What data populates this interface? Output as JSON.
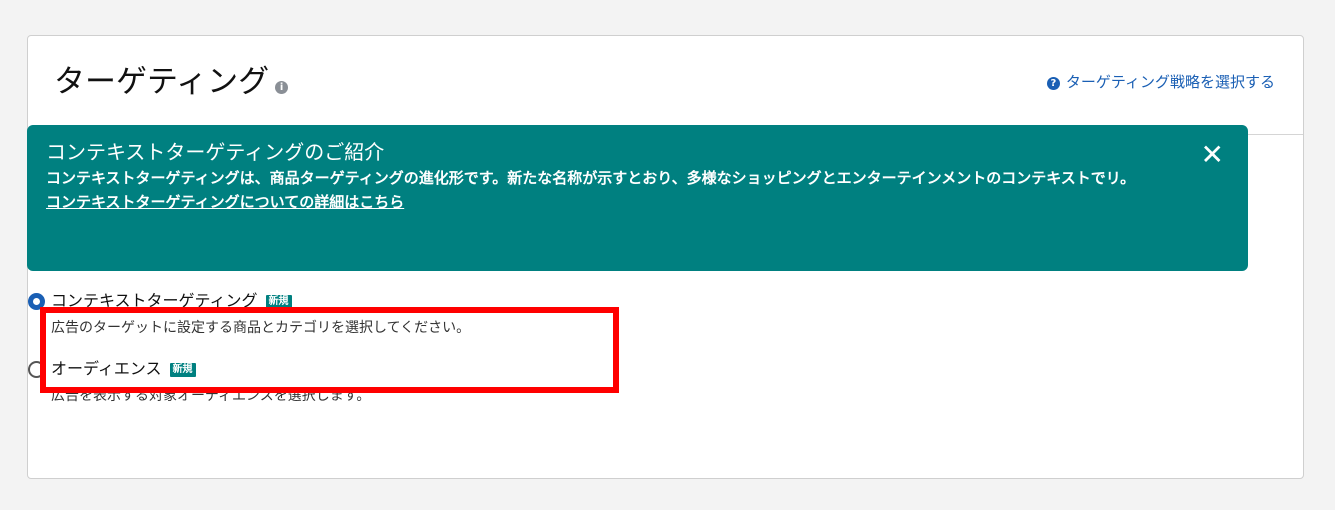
{
  "header": {
    "title": "ターゲティング",
    "info_icon": "info-icon",
    "strategy_link": "ターゲティング戦略を選択する",
    "help_icon": "question-circle-icon"
  },
  "banner": {
    "title": "コンテキストターゲティングのご紹介",
    "body": "コンテキストターゲティングは、商品ターゲティングの進化形です。新たな名称が示すとおり、多様なショッピングとエンターテインメントのコンテキストでリ。",
    "link": "コンテキストターゲティングについての詳細はこちら",
    "close_icon": "close-icon",
    "close_glyph": "✕",
    "background_color": "#008080"
  },
  "options": [
    {
      "label": "コンテキストターゲティング",
      "badge": "新規",
      "description": "広告のターゲットに設定する商品とカテゴリを選択してください。",
      "selected": true
    },
    {
      "label": "オーディエンス",
      "badge": "新規",
      "description": "広告を表示する対象オーディエンスを選択します。",
      "selected": false
    }
  ],
  "colors": {
    "accent": "#1a5fb4",
    "highlight": "#ff0000"
  }
}
